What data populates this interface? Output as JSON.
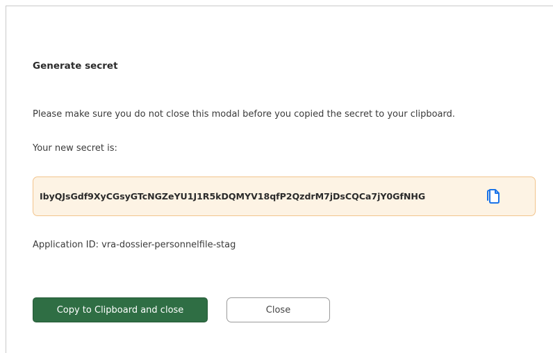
{
  "modal": {
    "title": "Generate secret",
    "warning": "Please make sure you do not close this modal before you copied the secret to your clipboard.",
    "secret_label": "Your new secret is:",
    "secret_value": "IbyQJsGdf9XyCGsyGTcNGZeYU1J1R5kDQMYV18qfP2QzdrM7jDsCQCa7jY0GfNHG",
    "copy_icon": "copy-icon",
    "application_id": "Application ID: vra-dossier-personnelfile-stag",
    "buttons": {
      "primary_label": "Copy to Clipboard and close",
      "secondary_label": "Close"
    }
  },
  "colors": {
    "primary_button": "#2f6e44",
    "secret_background": "#fdf3e4",
    "secret_border": "#f2c48c",
    "copy_icon": "#1a73e8"
  }
}
